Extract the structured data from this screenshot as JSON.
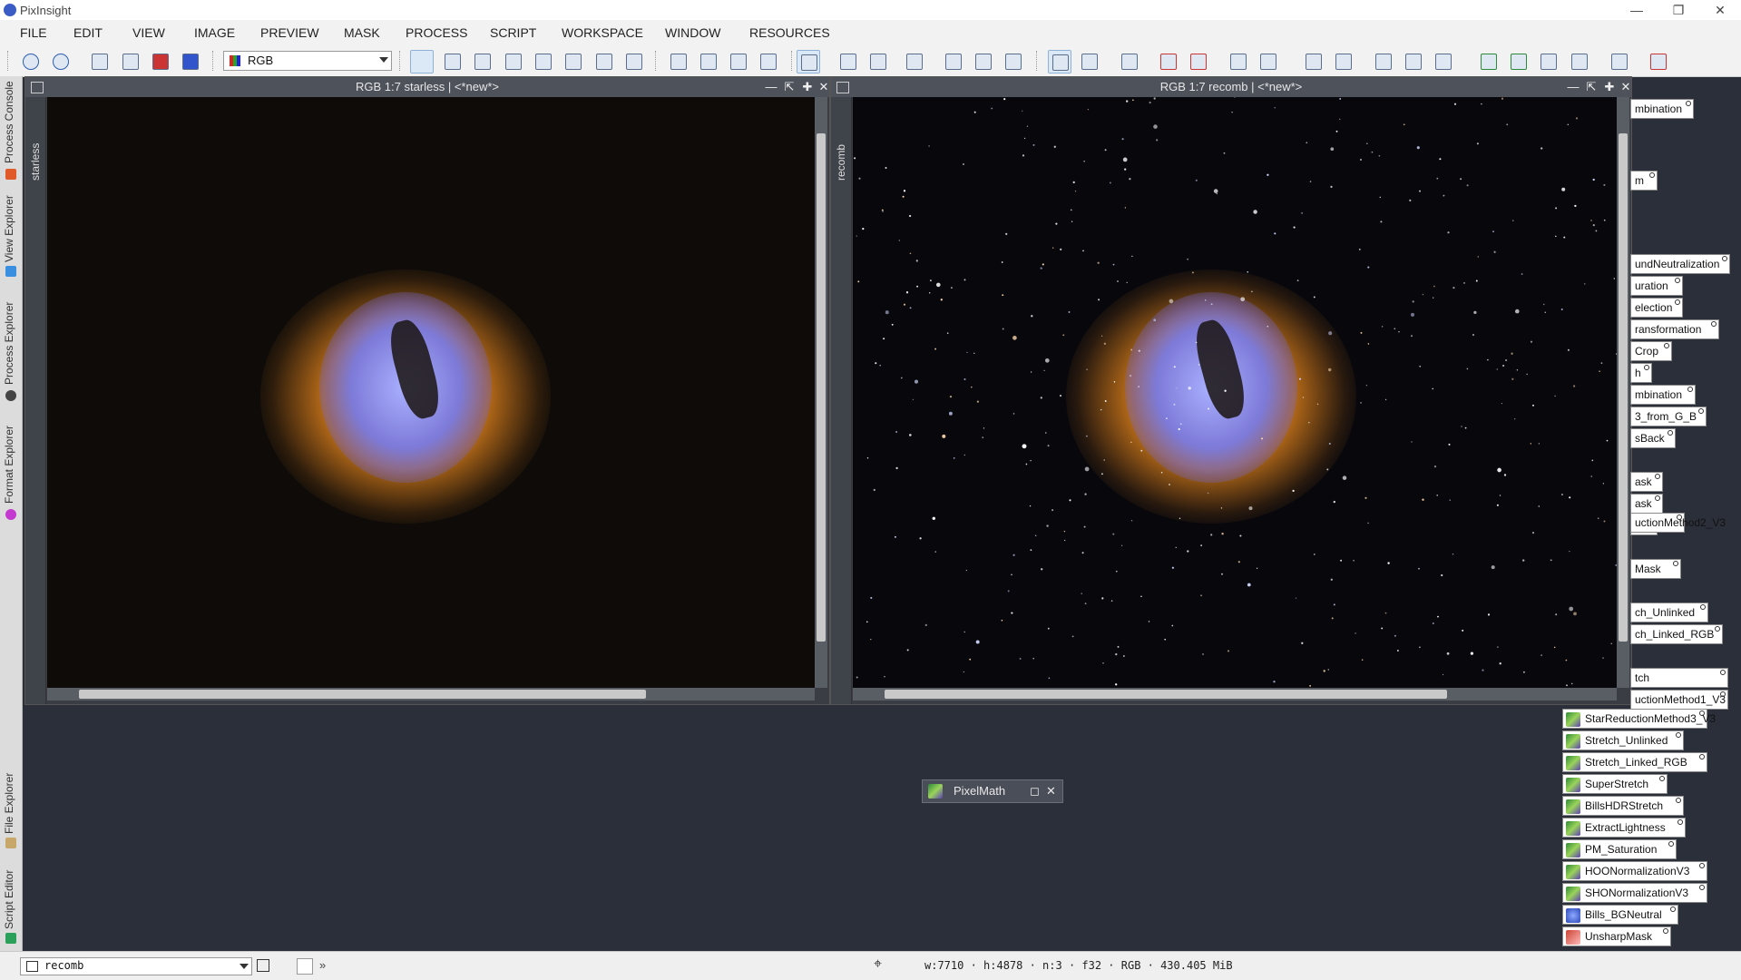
{
  "app": {
    "title": "PixInsight"
  },
  "menu": [
    "FILE",
    "EDIT",
    "VIEW",
    "IMAGE",
    "PREVIEW",
    "MASK",
    "PROCESS",
    "SCRIPT",
    "WORKSPACE",
    "WINDOW",
    "RESOURCES"
  ],
  "toolbar": {
    "channel_combo": "RGB"
  },
  "sidebar": {
    "tabs": [
      "Process Console",
      "View Explorer",
      "Process Explorer",
      "Format Explorer",
      "File Explorer",
      "Script Editor"
    ]
  },
  "windows": {
    "left": {
      "title": "RGB 1:7 starless | <*new*>",
      "tab": "starless"
    },
    "right": {
      "title": "RGB 1:7 recomb | <*new*>",
      "tab": "recomb"
    }
  },
  "process_icons_clipped": [
    "mbination",
    "m",
    "undNeutralization",
    "uration",
    "election",
    "ransformation",
    "Crop",
    "h",
    "mbination",
    "3_from_G_B",
    "sBack",
    "ask",
    "ask",
    "sk",
    "Mask",
    "ch_Unlinked",
    "ch_Linked_RGB",
    "tch",
    "uctionMethod1_V3",
    "uctionMethod2_V3"
  ],
  "process_icons": [
    {
      "label": "StarReductionMethod3_V3",
      "icon": "pm"
    },
    {
      "label": "Stretch_Unlinked",
      "icon": "pm"
    },
    {
      "label": "Stretch_Linked_RGB",
      "icon": "pm"
    },
    {
      "label": "SuperStretch",
      "icon": "pm"
    },
    {
      "label": "BillsHDRStretch",
      "icon": "pm"
    },
    {
      "label": "ExtractLightness",
      "icon": "pm"
    },
    {
      "label": "PM_Saturation",
      "icon": "pm"
    },
    {
      "label": "HOONormalizationV3",
      "icon": "pm"
    },
    {
      "label": "SHONormalizationV3",
      "icon": "pm"
    },
    {
      "label": "Bills_BGNeutral",
      "icon": "blue"
    },
    {
      "label": "UnsharpMask",
      "icon": "red"
    }
  ],
  "pixelmath": {
    "title": "PixelMath"
  },
  "status": {
    "view": "recomb",
    "info": "w:7710 · h:4878 · n:3 · f32 · RGB · 430.405 MiB"
  }
}
